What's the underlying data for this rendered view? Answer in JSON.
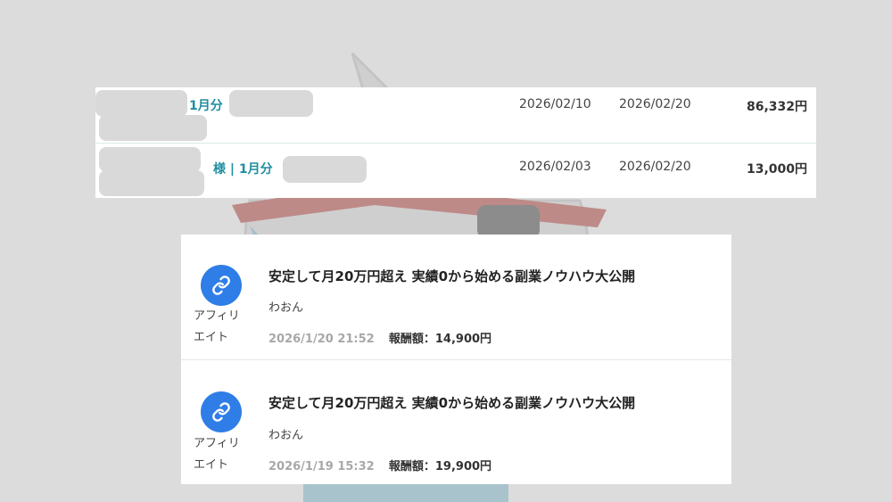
{
  "payments": [
    {
      "label": "1月分",
      "date1": "2026/02/10",
      "date2": "2026/02/20",
      "amount": "86,332円"
    },
    {
      "label": "様 | 1月分",
      "date1": "2026/02/03",
      "date2": "2026/02/20",
      "amount": "13,000円"
    }
  ],
  "affiliates": [
    {
      "type": "アフィリエイト",
      "title": "安定して月20万円超え 実績0から始める副業ノウハウ大公開",
      "user": "わおん",
      "time": "2026/1/20 21:52",
      "reward": "報酬額：14,900円"
    },
    {
      "type": "アフィリエイト",
      "title": "安定して月20万円超え 実績0から始める副業ノウハウ大公開",
      "user": "わおん",
      "time": "2026/1/19 15:32",
      "reward": "報酬額：19,900円"
    }
  ],
  "colors": {
    "accent_teal": "#1f8ea0",
    "link_blue": "#2f7de6",
    "background": "#dcdcdc"
  },
  "icons": {
    "affiliate": "link-icon"
  }
}
